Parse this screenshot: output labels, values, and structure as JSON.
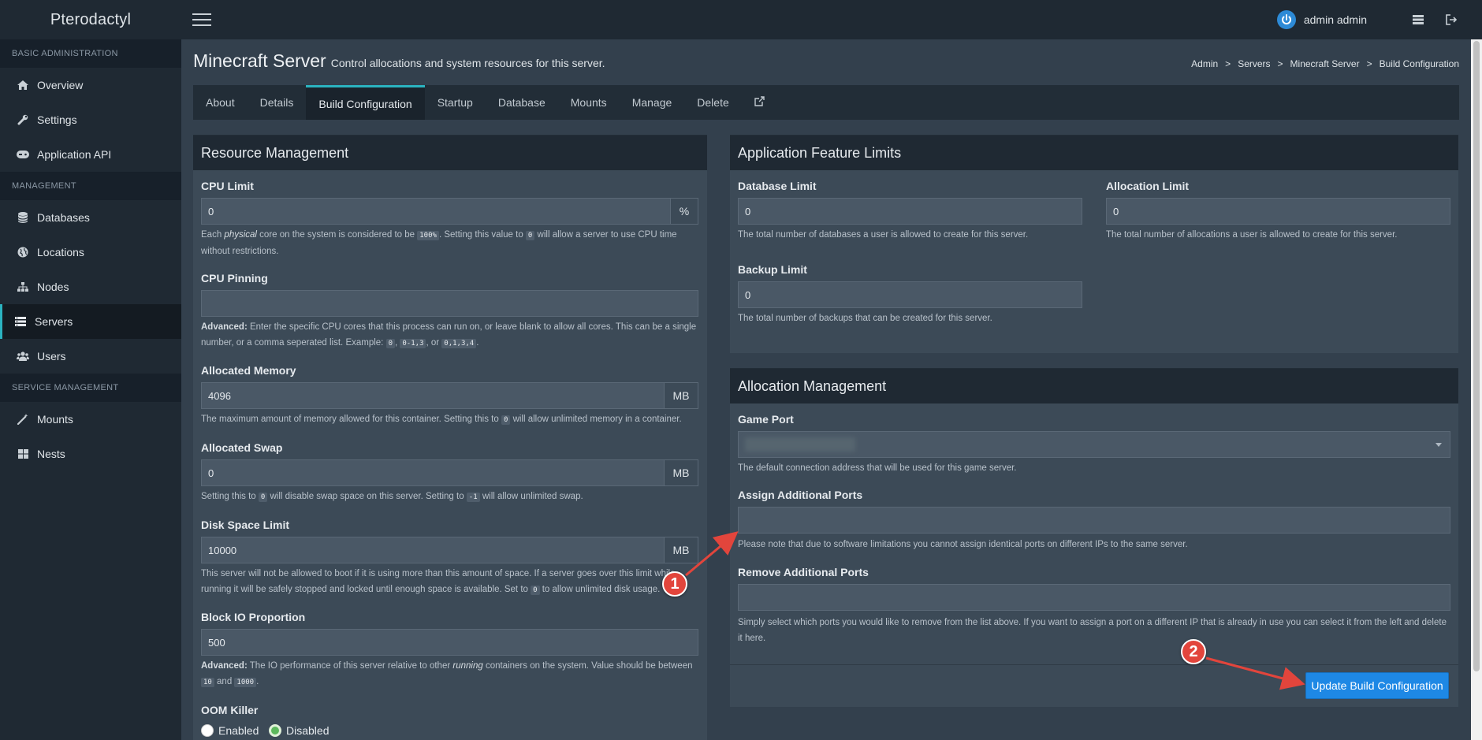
{
  "app": {
    "logo": "Pterodactyl",
    "user": "admin admin"
  },
  "sidebar": {
    "sections": [
      {
        "header": "BASIC ADMINISTRATION",
        "items": [
          {
            "label": "Overview",
            "icon": "home-icon"
          },
          {
            "label": "Settings",
            "icon": "wrench-icon"
          },
          {
            "label": "Application API",
            "icon": "gamepad-icon"
          }
        ]
      },
      {
        "header": "MANAGEMENT",
        "items": [
          {
            "label": "Databases",
            "icon": "database-icon"
          },
          {
            "label": "Locations",
            "icon": "globe-icon"
          },
          {
            "label": "Nodes",
            "icon": "sitemap-icon"
          },
          {
            "label": "Servers",
            "icon": "server-icon",
            "active": true
          },
          {
            "label": "Users",
            "icon": "users-icon"
          }
        ]
      },
      {
        "header": "SERVICE MANAGEMENT",
        "items": [
          {
            "label": "Mounts",
            "icon": "magic-icon"
          },
          {
            "label": "Nests",
            "icon": "th-large-icon"
          }
        ]
      }
    ]
  },
  "header": {
    "title": "Minecraft Server",
    "subtitle": "Control allocations and system resources for this server.",
    "breadcrumb": [
      "Admin",
      "Servers",
      "Minecraft Server",
      "Build Configuration"
    ]
  },
  "tabs": [
    "About",
    "Details",
    "Build Configuration",
    "Startup",
    "Database",
    "Mounts",
    "Manage",
    "Delete"
  ],
  "active_tab": "Build Configuration",
  "resource": {
    "title": "Resource Management",
    "cpu_limit": {
      "label": "CPU Limit",
      "value": "0",
      "addon": "%",
      "help_a": "Each ",
      "help_em": "physical",
      "help_b": " core on the system is considered to be ",
      "code1": "100%",
      "help_c": ". Setting this value to ",
      "code2": "0",
      "help_d": " will allow a server to use CPU time without restrictions."
    },
    "cpu_pinning": {
      "label": "CPU Pinning",
      "value": "",
      "help_strong": "Advanced:",
      "help_a": " Enter the specific CPU cores that this process can run on, or leave blank to allow all cores. This can be a single number, or a comma seperated list. Example: ",
      "code1": "0",
      "help_b": ", ",
      "code2": "0-1,3",
      "help_c": ", or ",
      "code3": "0,1,3,4",
      "help_d": "."
    },
    "memory": {
      "label": "Allocated Memory",
      "value": "4096",
      "addon": "MB",
      "help_a": "The maximum amount of memory allowed for this container. Setting this to ",
      "code1": "0",
      "help_b": " will allow unlimited memory in a container."
    },
    "swap": {
      "label": "Allocated Swap",
      "value": "0",
      "addon": "MB",
      "help_a": "Setting this to ",
      "code1": "0",
      "help_b": " will disable swap space on this server. Setting to ",
      "code2": "-1",
      "help_c": " will allow unlimited swap."
    },
    "disk": {
      "label": "Disk Space Limit",
      "value": "10000",
      "addon": "MB",
      "help_a": "This server will not be allowed to boot if it is using more than this amount of space. If a server goes over this limit while running it will be safely stopped and locked until enough space is available. Set to ",
      "code1": "0",
      "help_b": " to allow unlimited disk usage."
    },
    "block_io": {
      "label": "Block IO Proportion",
      "value": "500",
      "help_strong": "Advanced:",
      "help_a": " The IO performance of this server relative to other ",
      "help_em": "running",
      "help_b": " containers on the system. Value should be between ",
      "code1": "10",
      "help_c": " and ",
      "code2": "1000",
      "help_d": "."
    },
    "oom": {
      "label": "OOM Killer",
      "enabled": "Enabled",
      "disabled": "Disabled",
      "selected": "Disabled"
    }
  },
  "feature_limits": {
    "title": "Application Feature Limits",
    "database": {
      "label": "Database Limit",
      "value": "0",
      "help": "The total number of databases a user is allowed to create for this server."
    },
    "allocation": {
      "label": "Allocation Limit",
      "value": "0",
      "help": "The total number of allocations a user is allowed to create for this server."
    },
    "backup": {
      "label": "Backup Limit",
      "value": "0",
      "help": "The total number of backups that can be created for this server."
    }
  },
  "allocation_mgmt": {
    "title": "Allocation Management",
    "game_port": {
      "label": "Game Port",
      "help": "The default connection address that will be used for this game server."
    },
    "assign": {
      "label": "Assign Additional Ports",
      "value": "",
      "help": "Please note that due to software limitations you cannot assign identical ports on different IPs to the same server."
    },
    "remove": {
      "label": "Remove Additional Ports",
      "value": "",
      "help": "Simply select which ports you would like to remove from the list above. If you want to assign a port on a different IP that is already in use you can select it from the left and delete it here."
    },
    "submit": "Update Build Configuration"
  },
  "annotations": {
    "marker1": "1",
    "marker2": "2",
    "color": "#e2453c"
  },
  "colors": {
    "accent": "#2bb3c0",
    "primary_button": "#1e88e5",
    "success": "#5cb85c"
  }
}
